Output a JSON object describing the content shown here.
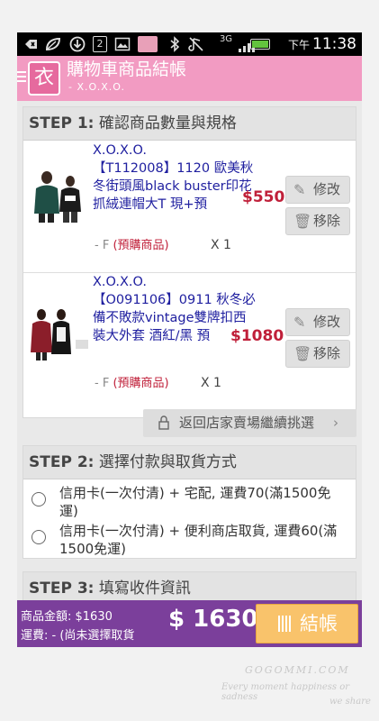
{
  "status_bar": {
    "ampm": "下午",
    "time": "11:38",
    "network": "3G",
    "icons": [
      "back-icon",
      "leaf-icon",
      "download-icon",
      "calendar-icon",
      "image-icon",
      "app-icon",
      "bluetooth-icon",
      "mute-icon",
      "signal-icon",
      "battery-icon"
    ],
    "calendar_day": "2"
  },
  "app_header": {
    "logo_glyph": "衣",
    "title": "購物車商品結帳",
    "subtitle": "- X.O.X.O."
  },
  "step1": {
    "label": "STEP 1:",
    "title": "確認商品數量與規格",
    "items": [
      {
        "name": "X.O.X.O.\n【T112008】1120 歐美秋冬街頭風black buster印花抓絨連帽大T 現+預",
        "price": "$550",
        "spec": "- F",
        "tag": "(預購商品)",
        "qty": "X 1",
        "edit_label": "修改",
        "remove_label": "移除"
      },
      {
        "name": "X.O.X.O.\n【O091106】0911 秋冬必備不敗款vintage雙牌扣西裝大外套 酒紅/黑 預",
        "price": "$1080",
        "spec": "- F",
        "tag": "(預購商品)",
        "qty": "X 1",
        "edit_label": "修改",
        "remove_label": "移除"
      }
    ],
    "back_label": "返回店家賣場繼續挑選"
  },
  "step2": {
    "label": "STEP 2:",
    "title": "選擇付款與取貨方式",
    "options": [
      {
        "text": "信用卡(一次付清) + 宅配, 運費70(滿1500免運)"
      },
      {
        "text": "信用卡(一次付清) + 便利商店取貨, 運費60(滿1500免運)"
      }
    ]
  },
  "step3": {
    "label": "STEP 3:",
    "title": "填寫收件資訊"
  },
  "bottom_bar": {
    "subtotal": "商品金額: $1630",
    "shipping": "運費: - (尚未選擇取貨",
    "total": "$ 1630",
    "checkout_label": "結帳"
  },
  "watermark": {
    "site": "GOGOMMI.COM",
    "line1": "Every moment happiness or sadness",
    "line2": "we share"
  },
  "colors": {
    "header_pink": "#f29bc2",
    "logo_pink": "#e66a9e",
    "price_red": "#c0203a",
    "name_blue": "#2020a0",
    "bottom_purple": "#7b3f9b",
    "checkout_orange": "#f9c36b"
  }
}
